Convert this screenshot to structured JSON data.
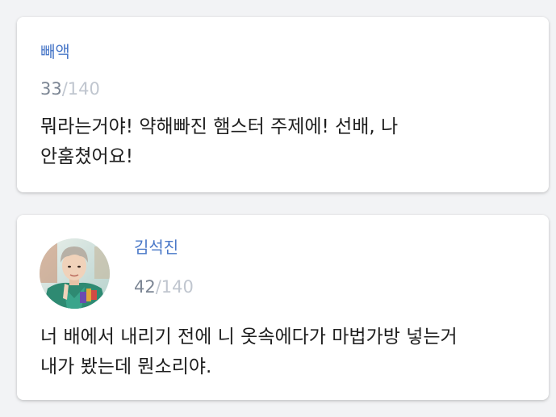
{
  "messages": [
    {
      "author": "빼액",
      "count_current": "33",
      "count_max": "/140",
      "lines": [
        "뭐라는거야! 약해빠진 햄스터 주제에! 선배, 나",
        "안훔쳤어요!"
      ]
    },
    {
      "author": "김석진",
      "count_current": "42",
      "count_max": "/140",
      "lines": [
        "너 배에서 내리기 전에 니 옷속에다가 마법가방 넣는거",
        "내가 봤는데 뭔소리야."
      ]
    }
  ]
}
